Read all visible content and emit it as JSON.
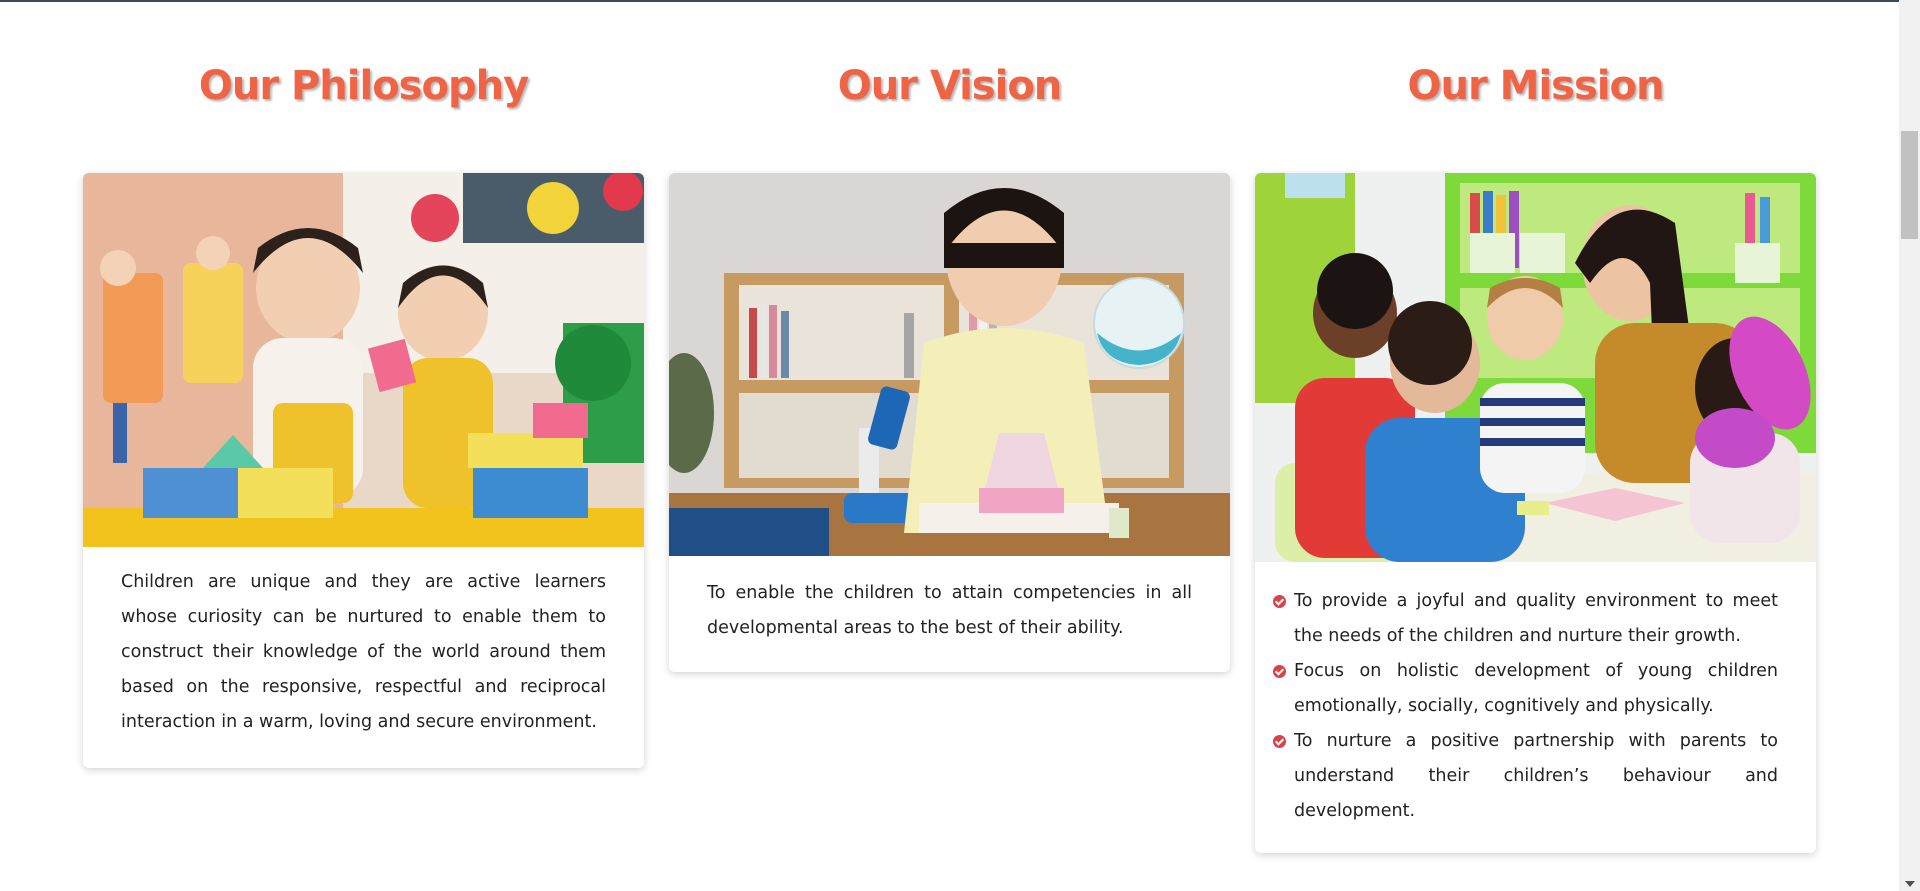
{
  "theme": {
    "accent": "#ee6445",
    "check_color": "#d8424a"
  },
  "philosophy": {
    "title": "Our Philosophy",
    "image_alt": "Two children playing with colourful building blocks",
    "text": "Children are unique and they are active learners whose curiosity can be nurtured to enable them to construct their knowledge of the world around them based on the responsive, respectful and reciprocal interaction in a warm, loving and secure environment."
  },
  "vision": {
    "title": "Our Vision",
    "image_alt": "Girl doing a science experiment with a microscope and flasks",
    "text": "To enable the children to attain competencies in all developmental areas to the best of their ability."
  },
  "mission": {
    "title": "Our Mission",
    "image_alt": "Teacher reading with a group of children at a table",
    "items": [
      "To provide a joyful and quality environment to meet the needs of the children and nurture their growth.",
      "Focus on holistic development of young children emotionally, socially, cognitively and physically.",
      "To nurture a positive partnership with parents to understand their children’s behaviour and development."
    ]
  }
}
